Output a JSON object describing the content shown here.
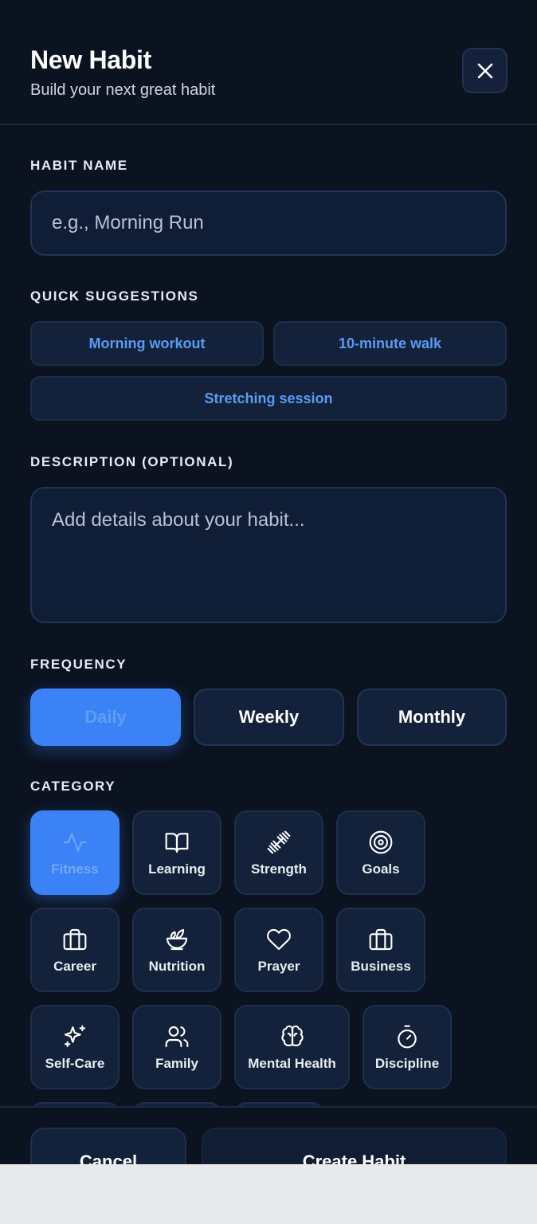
{
  "header": {
    "title": "New Habit",
    "subtitle": "Build your next great habit",
    "close_icon": "close-icon"
  },
  "habit_name": {
    "label": "HABIT NAME",
    "placeholder": "e.g., Morning Run",
    "value": ""
  },
  "suggestions": {
    "label": "QUICK SUGGESTIONS",
    "items": [
      "Morning workout",
      "10-minute walk",
      "Stretching session"
    ]
  },
  "description": {
    "label": "DESCRIPTION (OPTIONAL)",
    "placeholder": "Add details about your habit...",
    "value": ""
  },
  "frequency": {
    "label": "FREQUENCY",
    "options": [
      "Daily",
      "Weekly",
      "Monthly"
    ],
    "selected": "Daily"
  },
  "category": {
    "label": "CATEGORY",
    "selected": "Fitness",
    "items": [
      {
        "label": "Fitness",
        "icon": "activity-icon"
      },
      {
        "label": "Learning",
        "icon": "book-icon"
      },
      {
        "label": "Strength",
        "icon": "dumbbell-icon"
      },
      {
        "label": "Goals",
        "icon": "target-icon"
      },
      {
        "label": "Career",
        "icon": "briefcase-icon"
      },
      {
        "label": "Nutrition",
        "icon": "salad-icon"
      },
      {
        "label": "Prayer",
        "icon": "heart-icon"
      },
      {
        "label": "Business",
        "icon": "briefcase-icon"
      },
      {
        "label": "Self-Care",
        "icon": "sparkles-icon"
      },
      {
        "label": "Family",
        "icon": "users-icon"
      },
      {
        "label": "Mental Health",
        "icon": "brain-icon"
      },
      {
        "label": "Discipline",
        "icon": "timer-icon"
      }
    ]
  },
  "footer": {
    "cancel_label": "Cancel",
    "create_label": "Create Habit"
  },
  "colors": {
    "accent": "#3b82f6",
    "background": "#0b1321",
    "chip_text": "#5a9cf2"
  }
}
